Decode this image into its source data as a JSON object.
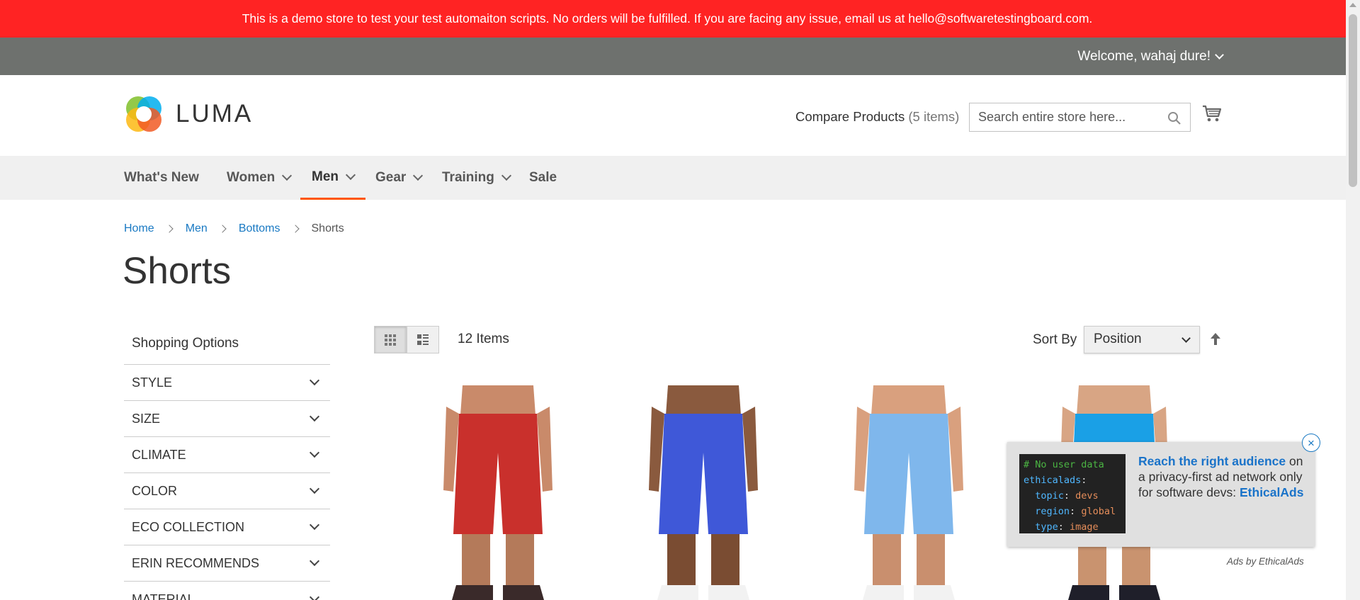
{
  "demo_notice": "This is a demo store to test your test automaiton scripts. No orders will be fulfilled. If you are facing any issue, email us at hello@softwaretestingboard.com.",
  "panel": {
    "welcome": "Welcome, wahaj dure!"
  },
  "header": {
    "logo_text": "LUMA",
    "compare_label": "Compare Products",
    "compare_count": "(5 items)",
    "search_placeholder": "Search entire store here..."
  },
  "nav": {
    "items": [
      {
        "label": "What's New"
      },
      {
        "label": "Women"
      },
      {
        "label": "Men"
      },
      {
        "label": "Gear"
      },
      {
        "label": "Training"
      },
      {
        "label": "Sale"
      }
    ]
  },
  "breadcrumbs": [
    "Home",
    "Men",
    "Bottoms",
    "Shorts"
  ],
  "page_title": "Shorts",
  "sidebar": {
    "title": "Shopping Options",
    "filters": [
      "STYLE",
      "SIZE",
      "CLIMATE",
      "COLOR",
      "ECO COLLECTION",
      "ERIN RECOMMENDS",
      "MATERIAL"
    ]
  },
  "toolbar": {
    "items_count": "12 Items",
    "sort_label": "Sort By",
    "sort_value": "Position"
  },
  "products": [
    {
      "shorts_color": "#c9302c",
      "shoes_color": "#3a2a2a"
    },
    {
      "shorts_color": "#3f58d8",
      "shoes_color": "#f2f2f2"
    },
    {
      "shorts_color": "#7fb7ec",
      "shoes_color": "#f2f2f2"
    },
    {
      "shorts_color": "#1aa0e6",
      "shoes_color": "#1f1f2a"
    }
  ],
  "ad": {
    "code": {
      "comment": "# No user data",
      "root": "ethicalads",
      "topic_key": "topic",
      "topic_val": "devs",
      "region_key": "region",
      "region_val": "global",
      "type_key": "type",
      "type_val": "image"
    },
    "headline": "Reach the right audience",
    "on": " on",
    "body": "a privacy-first ad network only for software devs:",
    "brand": "EthicalAds",
    "close": "×",
    "by": "Ads by EthicalAds"
  },
  "colors": {
    "demo_bar": "#ff2323",
    "panel_bar": "#6e716e",
    "link": "#1979c3",
    "nav_active_border": "#ff5501"
  }
}
